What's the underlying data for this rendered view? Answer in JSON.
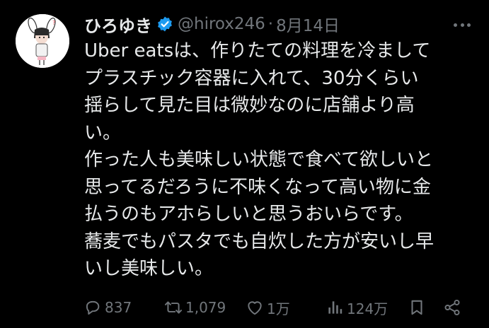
{
  "tweet": {
    "author_name": "ひろゆき",
    "handle": "@hirox246",
    "separator": "·",
    "date": "8月14日",
    "text_lines": [
      "Uber eatsは、作りたての料理を冷まして",
      "プラスチック容器に入れて、30分くらい",
      "揺らして見た目は微妙なのに店舗より高",
      "い。",
      "作った人も美味しい状態で食べて欲しいと",
      "思ってるだろうに不味くなって高い物に金",
      "払うのもアホらしいと思うおいらです。",
      "蕎麦でもパスタでも自炊した方が安いし早",
      "いし美味しい。"
    ]
  },
  "actions": {
    "replies": "837",
    "retweets": "1,079",
    "likes": "1万",
    "views": "124万"
  },
  "icons": {
    "verified": "verified-badge-icon",
    "more": "more-icon",
    "reply": "reply-icon",
    "retweet": "retweet-icon",
    "like": "heart-icon",
    "views": "views-icon",
    "bookmark": "bookmark-icon",
    "share": "share-icon"
  },
  "colors": {
    "background": "#000000",
    "text": "#e7e9ea",
    "muted": "#71767b",
    "verified": "#1d9bf0"
  }
}
